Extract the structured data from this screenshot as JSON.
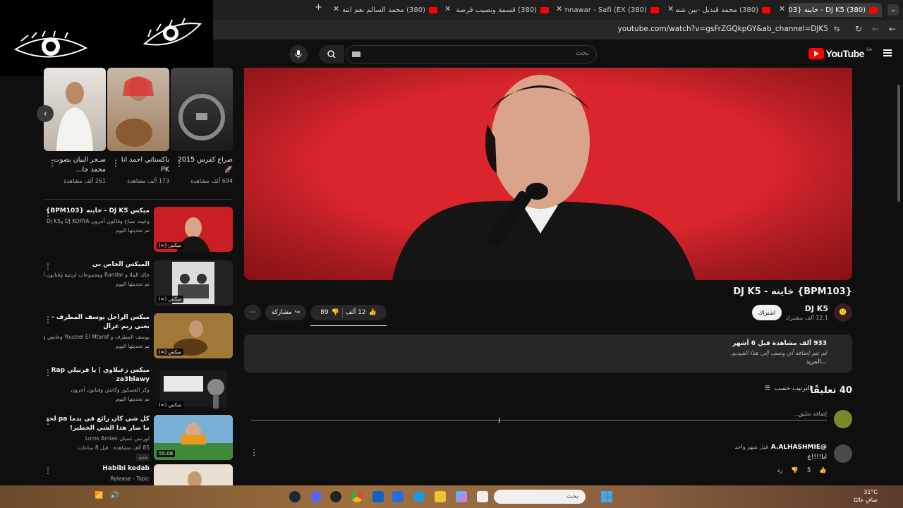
{
  "browser": {
    "tabs": [
      {
        "title": "(380) DJ K5 - خاينه {BPM103",
        "active": true
      },
      {
        "title": "(380) محمد قنديل -بين شطين و",
        "active": false
      },
      {
        "title": "(380) Asma Lmnawar - Safi (EX",
        "active": false
      },
      {
        "title": "(380) قسمة ونصيب فرصة ثانية",
        "active": false
      },
      {
        "title": "(380) محمد السالم نعم انته - ube",
        "active": false
      }
    ],
    "url": "youtube.com/watch?v=gsFrZGQkpGY&ab_channel=DJK5"
  },
  "header": {
    "search_placeholder": "بحث",
    "logo_text": "YouTube",
    "region": "SA"
  },
  "video": {
    "title": "{BPM103} خاينه - DJ K5"
  },
  "channel": {
    "name": "DJ K5",
    "subscribers": "12.1 ألف مشترك",
    "subscribe_label": "اشتراك"
  },
  "actions": {
    "likes": "12 ألف",
    "dislikes": "89",
    "share_label": "مشاركة"
  },
  "description": {
    "views_date": "933 ألف مشاهدة  قبل 6 أشهر",
    "text": "لم تتم إضافة أي وصف إلى هذا الفيديو.",
    "more": "...المزيد"
  },
  "comments": {
    "count": "40 تعليقًا",
    "sort_label": "الترتيب حسب",
    "add_placeholder": "إضافة تعليق...",
    "items": [
      {
        "author": "@A.ALHASHMIE",
        "time": "قبل شهر واحد",
        "text": "ابا!!!!ع",
        "likes": "5",
        "reply_label": "رد"
      }
    ]
  },
  "shorts": [
    {
      "title": "صراع كفرس 2015 🚀",
      "views": "694 ألف مشاهدة"
    },
    {
      "title": "باكستاني احمد انا PK",
      "views": "173 ألف مشاهدة"
    },
    {
      "title": "سـحر البيان بصوت محمد جا...",
      "views": "261 ألف مشاهدة"
    }
  ],
  "recommendations": [
    {
      "title": "ميكس DJ K5 - خاينه {BPM103}",
      "channel": "وعيث صباح وقاكون آخرون DJ KORYA وDj K5",
      "meta": "تم تحديثها اليوم",
      "badge": "ميكس (∞)"
    },
    {
      "title": "الميكس الخاص بي",
      "channel": "خالد الملا و Randar ومجموعات اردنية وفنانون آخرون",
      "meta": "تم تحديثها اليوم",
      "badge": "ميكس (∞)"
    },
    {
      "title": "ميكس الراحل يوسف المطرف - يغني ريم عزال",
      "channel": "يوسف المطرف و Youssel El Mtaraf وعايض وفنانون",
      "meta": "تم تحديثها اليوم",
      "badge": "ميكس (∞)"
    },
    {
      "title": "ميكس زعبلاوي | يا فرنيلي Rap za3blawy",
      "channel": "وكر العسكور وكاتش وفنانون آخرون",
      "meta": "تم تحديثها اليوم",
      "badge": "ميكس (∞)"
    },
    {
      "title": "كل شي كان رائع في بدما pa لحد ما صار هذا الشي الخطير!",
      "channel": "لورنس عميان Loms Amian",
      "meta": "85 ألف مشاهدة · قبل 8 ساعات",
      "badge": "55:08",
      "new": "جديد"
    },
    {
      "title": "Habibi kedab",
      "channel": "Release - Topic",
      "meta": "",
      "badge": ""
    }
  ],
  "taskbar": {
    "search_placeholder": "بحث",
    "temperature": "31°C",
    "weather": "صافٍ غالبًا"
  }
}
